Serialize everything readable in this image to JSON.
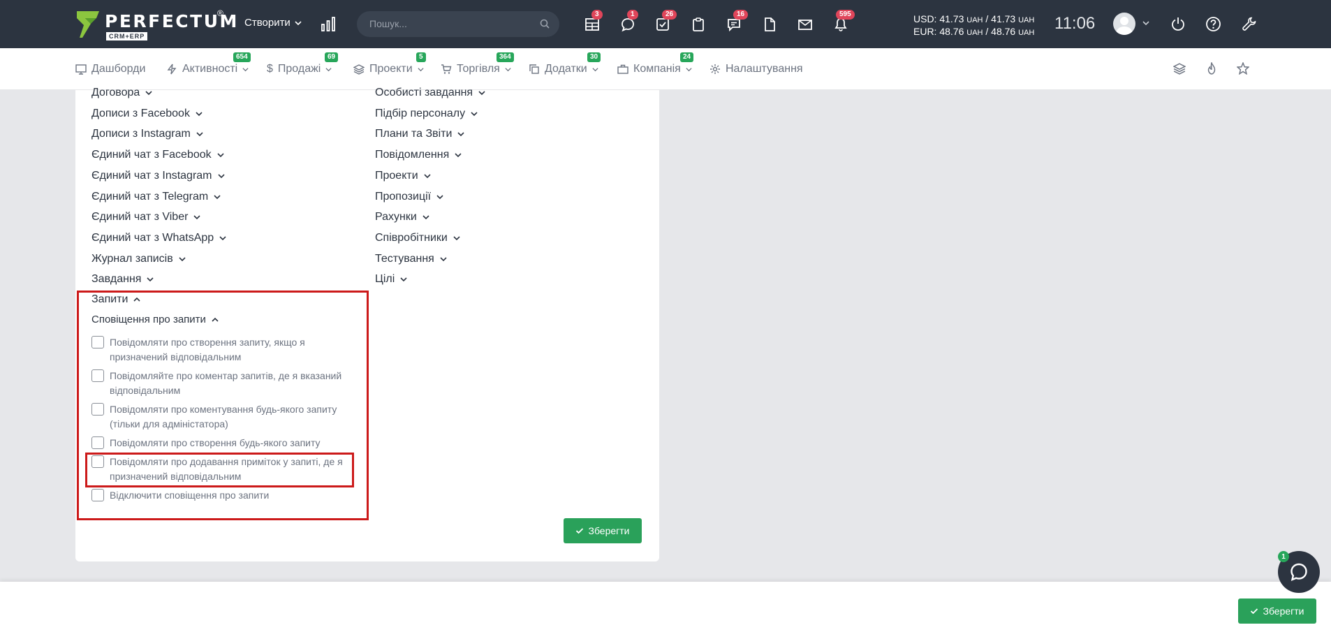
{
  "header": {
    "logo_text": "PERFECTUM",
    "logo_reg": "®",
    "logo_sub": "CRM+ERP",
    "create_label": "Створити",
    "search_placeholder": "Пошук...",
    "badges": {
      "requests": "3",
      "chats": "1",
      "tasks": "26",
      "messages": "16",
      "notifications": "595"
    },
    "usd_label": "USD: 41.73",
    "usd_unit1": "UAH",
    "usd_sep": " / 41.73",
    "usd_unit2": "UAH",
    "eur_label": "EUR: 48.76",
    "eur_unit1": "UAH",
    "eur_sep": " / 48.76",
    "eur_unit2": "UAH",
    "time": "11:06"
  },
  "nav": {
    "items": [
      {
        "label": "Дашборди",
        "badge": ""
      },
      {
        "label": "Активності",
        "badge": "654"
      },
      {
        "label": "Продажі",
        "badge": "69"
      },
      {
        "label": "Проекти",
        "badge": "5"
      },
      {
        "label": "Торгівля",
        "badge": "364"
      },
      {
        "label": "Додатки",
        "badge": "30"
      },
      {
        "label": "Компанія",
        "badge": "24"
      },
      {
        "label": "Налаштування",
        "badge": ""
      }
    ]
  },
  "settings": {
    "left_column": [
      "Договора",
      "Дописи з Facebook",
      "Дописи з Instagram",
      "Єдиний чат з Facebook",
      "Єдиний чат з Instagram",
      "Єдиний чат з Telegram",
      "Єдиний чат з Viber",
      "Єдиний чат з WhatsApp",
      "Журнал записів",
      "Завдання"
    ],
    "right_column": [
      "Особисті завдання",
      "Підбір персоналу",
      "Плани та Звіти",
      "Повідомлення",
      "Проекти",
      "Пропозиції",
      "Рахунки",
      "Співробітники",
      "Тестування",
      "Цілі"
    ],
    "section_title": "Запити",
    "subsection_title": "Сповіщення про запити",
    "options": [
      "Повідомляти про створення запиту, якщо я призначений відповідальним",
      "Повідомляйте про коментар запитів, де я вказаний відповідальним",
      "Повідомляти про коментування будь-якого запиту (тільки для адміністатора)",
      "Повідомляти про створення будь-якого запиту",
      "Повідомляти про додавання приміток у запиті, де я призначений відповідальним",
      "Відключити сповіщення про запити"
    ],
    "save_label": "Зберегти"
  },
  "footer": {
    "save_label": "Зберегти",
    "chat_badge": "1"
  },
  "colors": {
    "topbar": "#2c3440",
    "accent_green": "#2aa15a",
    "badge_red": "#e0455a",
    "highlight_red": "#cc1a1a"
  }
}
